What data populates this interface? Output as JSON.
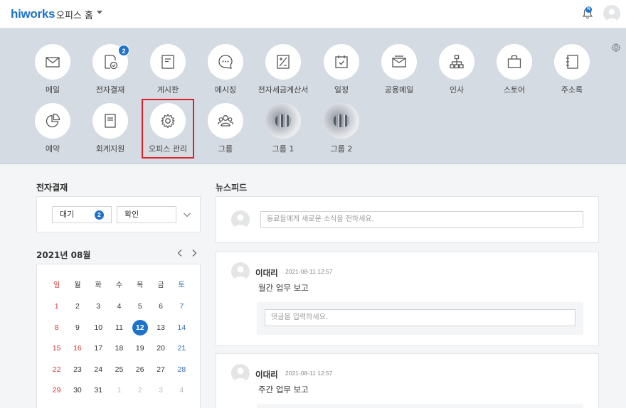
{
  "header": {
    "logo": "hiworks",
    "home_label": "오피스 홈",
    "notification_badge": "N"
  },
  "apps": [
    {
      "label": "메일",
      "icon": "mail-icon"
    },
    {
      "label": "전자결재",
      "icon": "approval-icon",
      "badge": "2"
    },
    {
      "label": "게시판",
      "icon": "board-icon"
    },
    {
      "label": "메시징",
      "icon": "messaging-icon"
    },
    {
      "label": "전자세금계산서",
      "icon": "tax-invoice-icon"
    },
    {
      "label": "일정",
      "icon": "calendar-icon"
    },
    {
      "label": "공용메일",
      "icon": "shared-mail-icon"
    },
    {
      "label": "인사",
      "icon": "org-chart-icon"
    },
    {
      "label": "스토어",
      "icon": "store-bag-icon"
    },
    {
      "label": "주소록",
      "icon": "address-book-icon"
    },
    {
      "label": "예약",
      "icon": "reservation-pie-icon"
    },
    {
      "label": "회계지원",
      "icon": "accounting-icon"
    },
    {
      "label": "오피스 관리",
      "icon": "gear-icon",
      "highlighted": true
    },
    {
      "label": "그룹",
      "icon": "group-icon"
    },
    {
      "label": "그룹 1",
      "icon": "group-photo"
    },
    {
      "label": "그룹 2",
      "icon": "group-photo"
    }
  ],
  "approval": {
    "title": "전자결재",
    "wait_label": "대기",
    "wait_count": "2",
    "confirm_label": "확인"
  },
  "calendar": {
    "title": "2021년 08월",
    "weekdays": [
      "일",
      "월",
      "화",
      "수",
      "목",
      "금",
      "토"
    ],
    "weeks": [
      [
        "1",
        "2",
        "3",
        "4",
        "5",
        "6",
        "7"
      ],
      [
        "8",
        "9",
        "10",
        "11",
        "12",
        "13",
        "14"
      ],
      [
        "15",
        "16",
        "17",
        "18",
        "19",
        "20",
        "21"
      ],
      [
        "22",
        "23",
        "24",
        "25",
        "26",
        "27",
        "28"
      ],
      [
        "29",
        "30",
        "31",
        "1",
        "2",
        "3",
        "4"
      ]
    ],
    "today": "12",
    "holiday_extra": "16"
  },
  "newsfeed": {
    "title": "뉴스피드",
    "compose_placeholder": "동료들에게 새로운 소식을 전하세요.",
    "posts": [
      {
        "author": "이대리",
        "time": "2021-08-11 12:57",
        "text": "월간 업무 보고",
        "comment_placeholder": "댓글을 입력하세요."
      },
      {
        "author": "이대리",
        "time": "2021-08-11 12:57",
        "text": "주간 업무 보고"
      }
    ]
  },
  "colors": {
    "brand": "#1d72c9",
    "panel_bg": "#d5dbe2",
    "highlight_border": "#e21f26",
    "sunday": "#d33636",
    "saturday": "#2f6db5"
  }
}
